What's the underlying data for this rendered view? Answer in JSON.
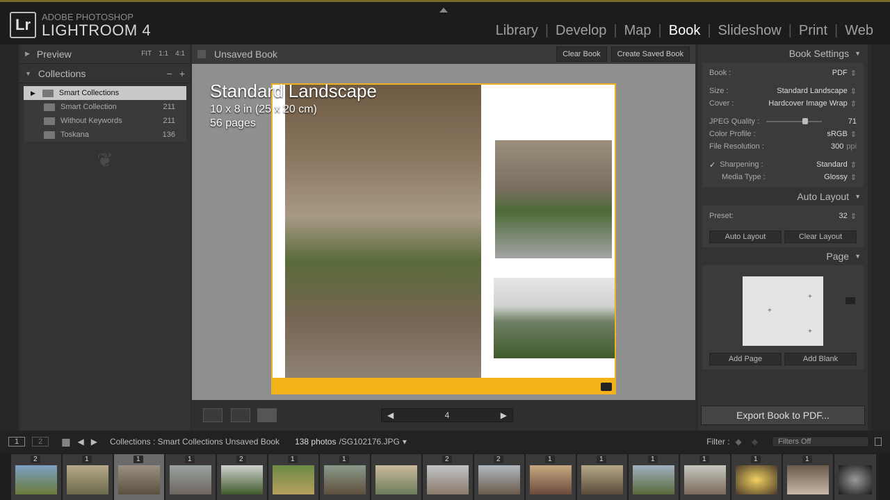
{
  "app": {
    "brand_top": "ADOBE PHOTOSHOP",
    "brand_main": "LIGHTROOM 4",
    "logo": "Lr"
  },
  "modules": [
    "Library",
    "Develop",
    "Map",
    "Book",
    "Slideshow",
    "Print",
    "Web"
  ],
  "active_module": "Book",
  "left": {
    "preview": {
      "title": "Preview",
      "fit": "FIT",
      "one": "1:1",
      "four": "4:1"
    },
    "collections": {
      "title": "Collections",
      "items": [
        {
          "name": "Smart Collections",
          "count": ""
        },
        {
          "name": "Smart Collection",
          "count": "211"
        },
        {
          "name": "Without Keywords",
          "count": "211"
        },
        {
          "name": "Toskana",
          "count": "136"
        }
      ]
    }
  },
  "center": {
    "title": "Unsaved Book",
    "clear_book": "Clear Book",
    "create_saved_book": "Create Saved Book",
    "book_type": "Standard Landscape",
    "book_size": "10 x 8 in (25 x 20 cm)",
    "book_pages": "56 pages",
    "page_number": "4"
  },
  "right": {
    "book_settings": {
      "title": "Book Settings",
      "book_label": "Book :",
      "book_value": "PDF",
      "size_label": "Size :",
      "size_value": "Standard Landscape",
      "cover_label": "Cover :",
      "cover_value": "Hardcover Image Wrap",
      "jpeg_label": "JPEG Quality :",
      "jpeg_value": "71",
      "color_label": "Color Profile :",
      "color_value": "sRGB",
      "res_label": "File Resolution :",
      "res_value": "300",
      "res_unit": "ppi",
      "sharp_label": "Sharpening :",
      "sharp_value": "Standard",
      "media_label": "Media Type :",
      "media_value": "Glossy"
    },
    "auto_layout": {
      "title": "Auto Layout",
      "preset_label": "Preset:",
      "preset_value": "32",
      "auto_btn": "Auto Layout",
      "clear_btn": "Clear Layout"
    },
    "page": {
      "title": "Page",
      "add_page": "Add Page",
      "add_blank": "Add Blank"
    },
    "export": "Export Book to PDF..."
  },
  "filmbar": {
    "monitor1": "1",
    "monitor2": "2",
    "path": "Collections : Smart Collections Unsaved Book",
    "photos": "138 photos",
    "file": "/SG102176.JPG",
    "filter_label": "Filter :",
    "filter_value": "Filters Off"
  },
  "filmstrip": [
    "2",
    "1",
    "1",
    "1",
    "2",
    "1",
    "1",
    "",
    "2",
    "2",
    "1",
    "1",
    "1",
    "1",
    "1",
    "1",
    ""
  ]
}
